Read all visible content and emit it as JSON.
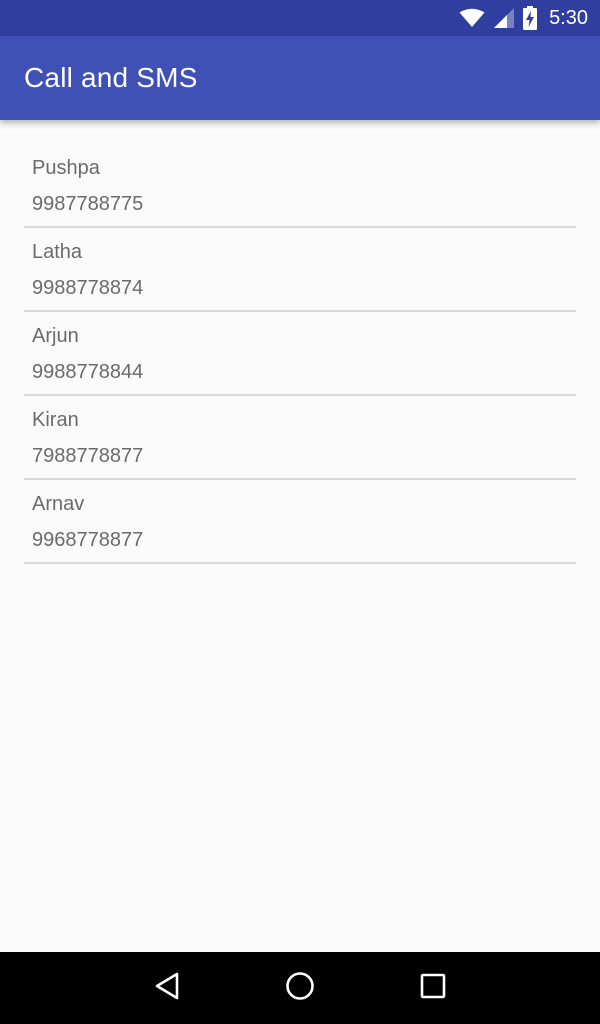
{
  "status_bar": {
    "time": "5:30",
    "icons": [
      "wifi-icon",
      "cell-signal-icon",
      "battery-charging-icon"
    ]
  },
  "app_bar": {
    "title": "Call and SMS"
  },
  "contacts": [
    {
      "name": "Pushpa",
      "phone": "9987788775"
    },
    {
      "name": "Latha",
      "phone": "9988778874"
    },
    {
      "name": "Arjun",
      "phone": "9988778844"
    },
    {
      "name": "Kiran",
      "phone": "7988778877"
    },
    {
      "name": "Arnav",
      "phone": "9968778877"
    }
  ],
  "nav_bar": {
    "icons": [
      "back-icon",
      "home-icon",
      "recents-icon"
    ]
  },
  "colors": {
    "status_bar": "#303f9f",
    "app_bar": "#3f51b5",
    "background": "#fafafa",
    "text": "#6b6b6b",
    "divider": "#d9d9d9"
  }
}
